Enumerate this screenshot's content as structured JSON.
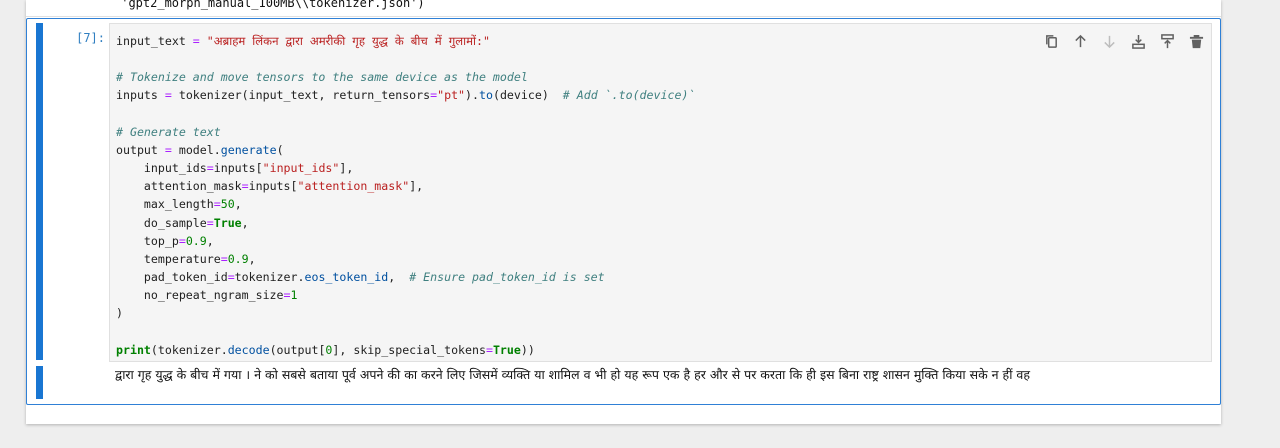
{
  "prev_output": {
    "line": " 'gpt2_morph_manual_100MB\\\\tokenizer.json')"
  },
  "cell": {
    "prompt": "[7]:",
    "code_lines": [
      [
        [
          "input_text",
          ""
        ],
        [
          " ",
          ""
        ],
        [
          "=",
          "op"
        ],
        [
          " ",
          ""
        ],
        [
          "\"अब्राहम लिंकन द्वारा अमरीकी गृह युद्ध के बीच में गुलामों:\"",
          "str"
        ]
      ],
      [],
      [
        [
          "# Tokenize and move tensors to the same device as the model",
          "com"
        ]
      ],
      [
        [
          "inputs ",
          ""
        ],
        [
          "=",
          "op"
        ],
        [
          " tokenizer(input_text, return_tensors",
          ""
        ],
        [
          "=",
          "op"
        ],
        [
          "\"pt\"",
          "str"
        ],
        [
          ").",
          ""
        ],
        [
          "to",
          "fn"
        ],
        [
          "(device)  ",
          ""
        ],
        [
          "# Add `.to(device)`",
          "com"
        ]
      ],
      [],
      [
        [
          "# Generate text",
          "com"
        ]
      ],
      [
        [
          "output ",
          ""
        ],
        [
          "=",
          "op"
        ],
        [
          " model.",
          ""
        ],
        [
          "generate",
          "fn"
        ],
        [
          "(",
          ""
        ]
      ],
      [
        [
          "    input_ids",
          ""
        ],
        [
          "=",
          "op"
        ],
        [
          "inputs[",
          ""
        ],
        [
          "\"input_ids\"",
          "str"
        ],
        [
          "],",
          ""
        ]
      ],
      [
        [
          "    attention_mask",
          ""
        ],
        [
          "=",
          "op"
        ],
        [
          "inputs[",
          ""
        ],
        [
          "\"attention_mask\"",
          "str"
        ],
        [
          "],",
          ""
        ]
      ],
      [
        [
          "    max_length",
          ""
        ],
        [
          "=",
          "op"
        ],
        [
          "50",
          "num"
        ],
        [
          ",",
          ""
        ]
      ],
      [
        [
          "    do_sample",
          ""
        ],
        [
          "=",
          "op"
        ],
        [
          "True",
          "kw"
        ],
        [
          ",",
          ""
        ]
      ],
      [
        [
          "    top_p",
          ""
        ],
        [
          "=",
          "op"
        ],
        [
          "0.9",
          "num"
        ],
        [
          ",",
          ""
        ]
      ],
      [
        [
          "    temperature",
          ""
        ],
        [
          "=",
          "op"
        ],
        [
          "0.9",
          "num"
        ],
        [
          ",",
          ""
        ]
      ],
      [
        [
          "    pad_token_id",
          ""
        ],
        [
          "=",
          "op"
        ],
        [
          "tokenizer.",
          ""
        ],
        [
          "eos_token_id",
          "fn"
        ],
        [
          ",  ",
          ""
        ],
        [
          "# Ensure pad_token_id is set",
          "com"
        ]
      ],
      [
        [
          "    no_repeat_ngram_size",
          ""
        ],
        [
          "=",
          "op"
        ],
        [
          "1",
          "num"
        ]
      ],
      [
        [
          ")",
          ""
        ]
      ],
      [],
      [
        [
          "print",
          "kw2"
        ],
        [
          "(tokenizer.",
          ""
        ],
        [
          "decode",
          "fn"
        ],
        [
          "(output[",
          ""
        ],
        [
          "0",
          "num"
        ],
        [
          "], skip_special_tokens",
          ""
        ],
        [
          "=",
          "op"
        ],
        [
          "True",
          "kw"
        ],
        [
          "))",
          ""
        ]
      ]
    ],
    "output_text": "द्वारा गृह युद्ध के बीच में गया । ने को सबसे बताया पूर्व अपने की का करने लिए जिसमें व्यक्ति या शामिल व भी हो यह रूप एक है हर और से पर करता कि ही इस बिना राष्ट्र शासन मुक्ति किया सके न हीं वह"
  },
  "toolbar": {
    "buttons": [
      {
        "name": "duplicate-cell-button",
        "icon": "copy-icon",
        "enabled": true
      },
      {
        "name": "move-up-button",
        "icon": "arrow-up-icon",
        "enabled": true
      },
      {
        "name": "move-down-button",
        "icon": "arrow-down-icon",
        "enabled": false
      },
      {
        "name": "insert-above-button",
        "icon": "insert-above-icon",
        "enabled": true
      },
      {
        "name": "insert-below-button",
        "icon": "insert-below-icon",
        "enabled": true
      },
      {
        "name": "delete-cell-button",
        "icon": "trash-icon",
        "enabled": true
      }
    ]
  },
  "colors": {
    "accent": "#1976d2",
    "prompt": "#307fc1",
    "string": "#ba2121",
    "comment": "#408080",
    "number": "#008000"
  }
}
